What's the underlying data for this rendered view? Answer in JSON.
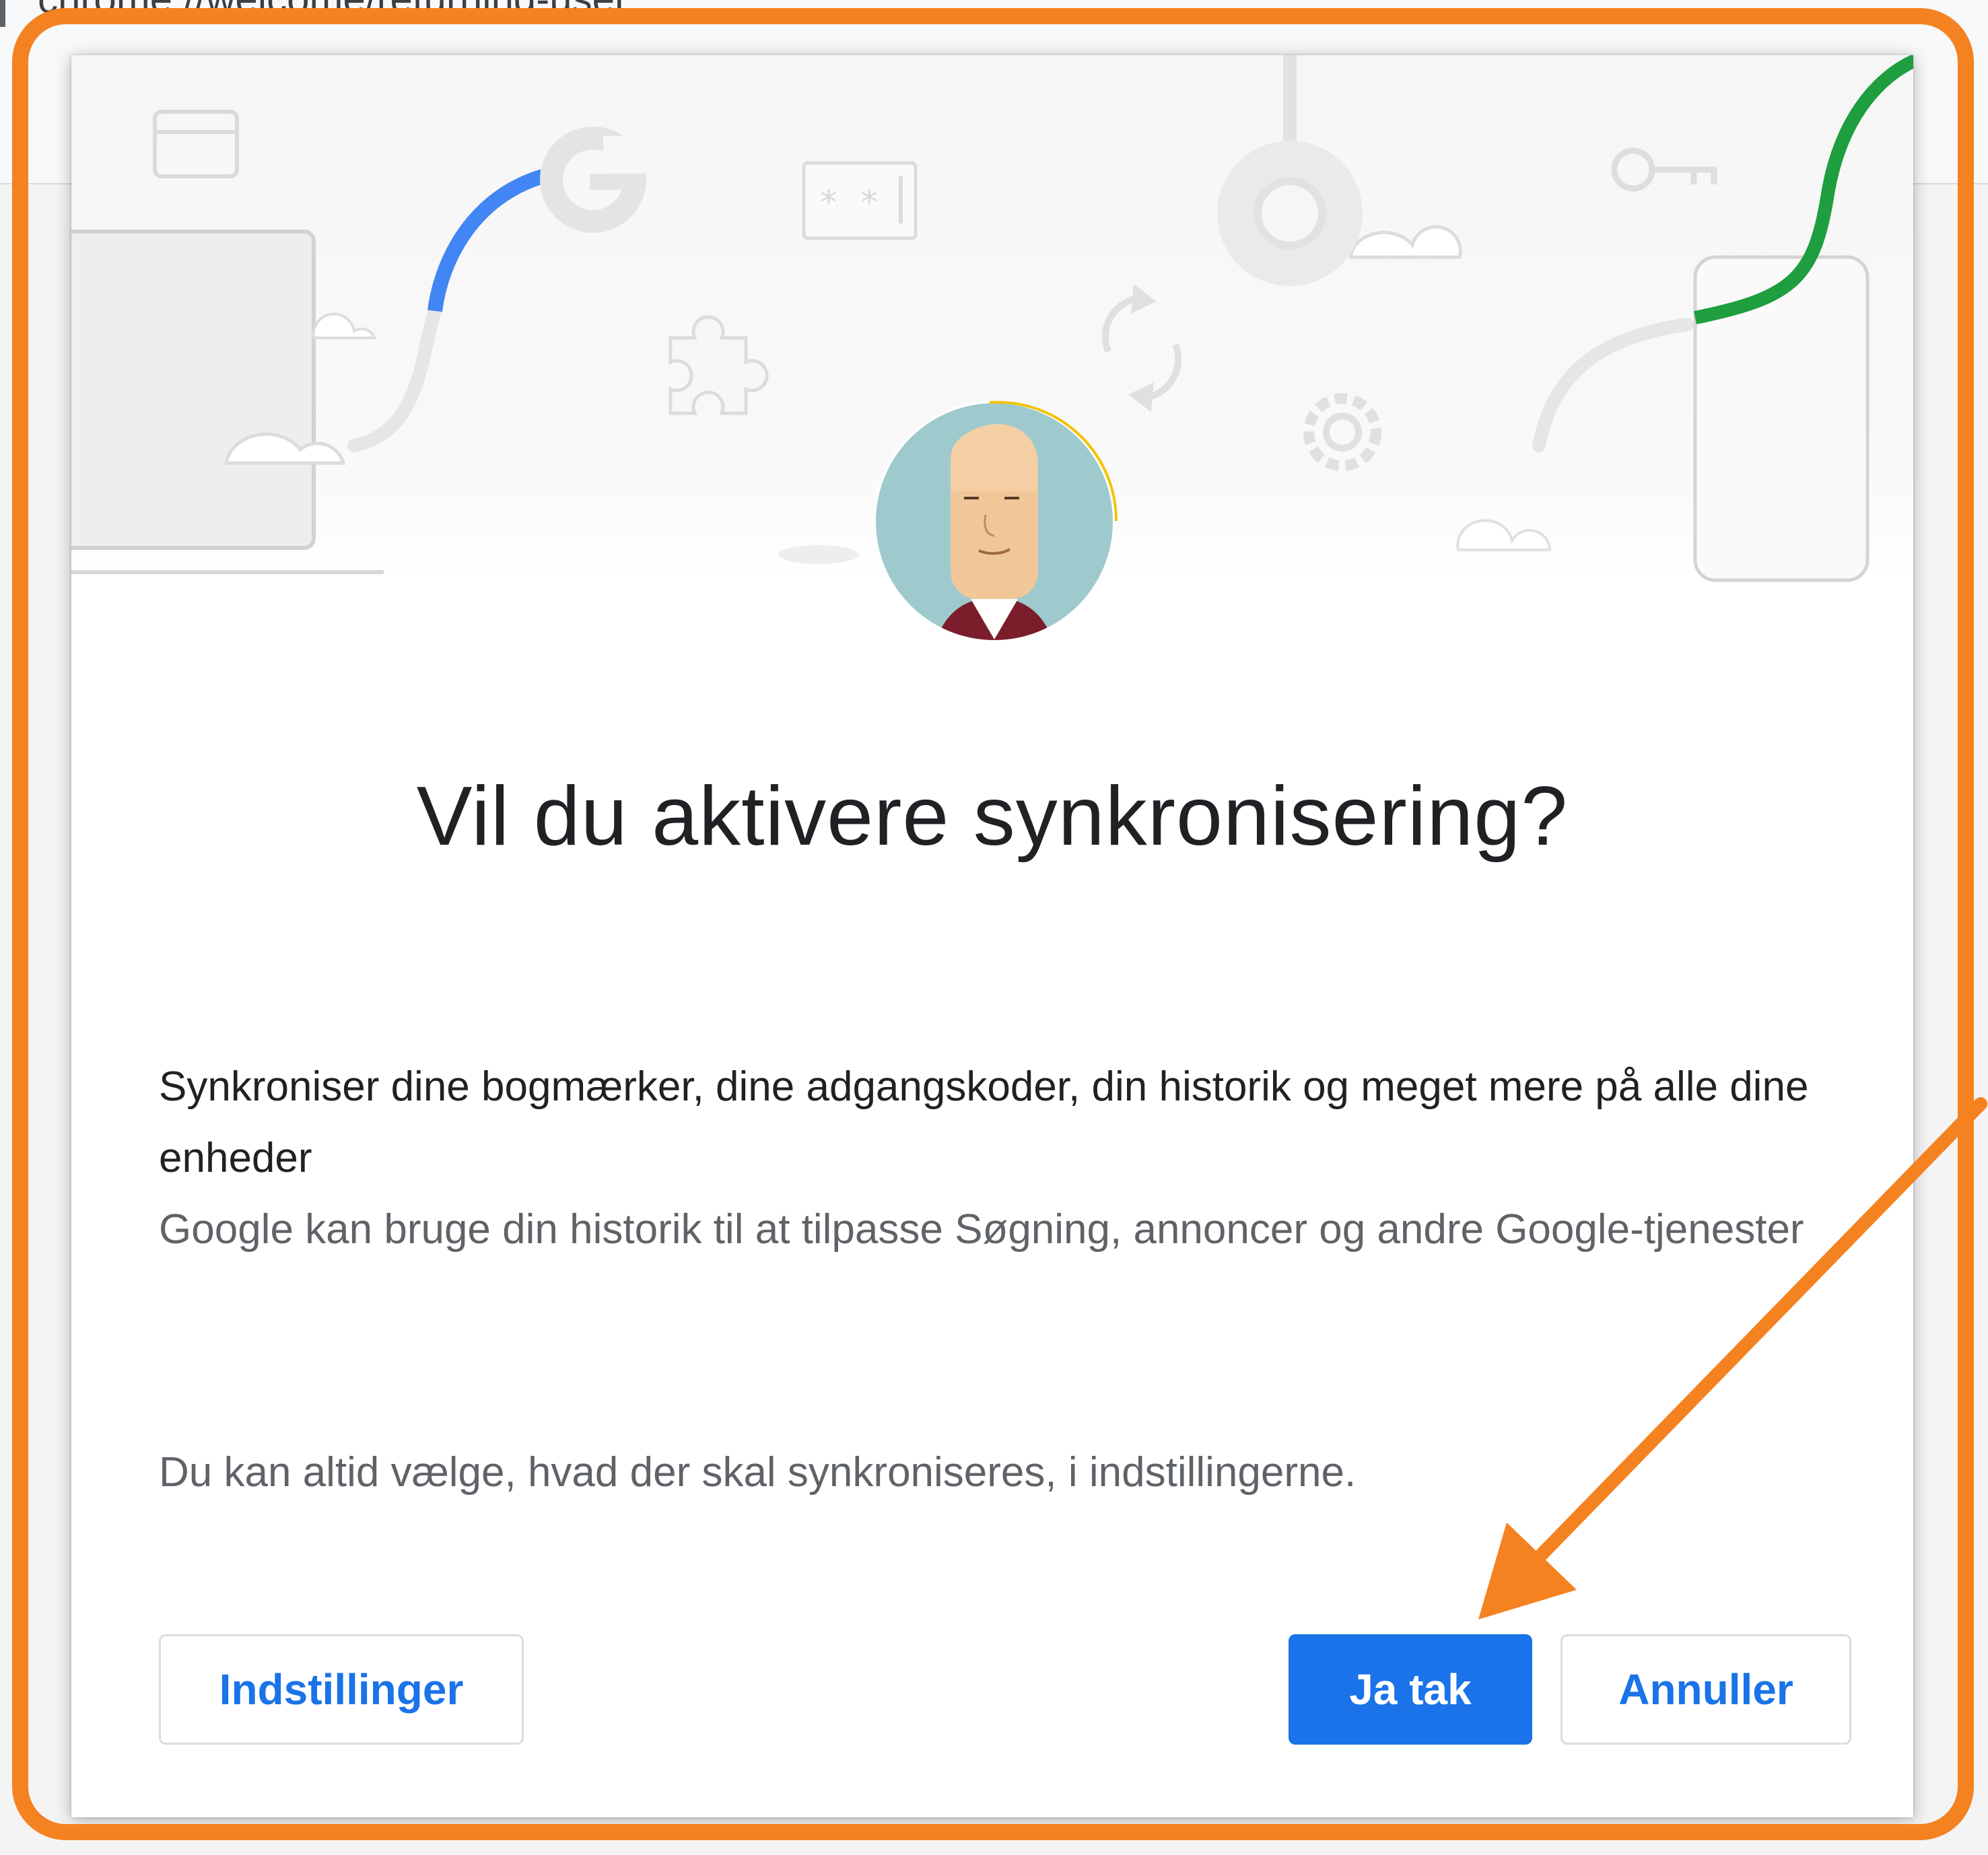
{
  "browser": {
    "url": "chrome://welcome/returning-user"
  },
  "dialog": {
    "title": "Vil du aktivere synkronisering?",
    "primary_text": "Synkroniser dine bogmærker, dine adgangskoder, din historik og meget mere på alle dine enheder",
    "secondary_text": "Google kan bruge din historik til at tilpasse Søgning, annoncer og andre Google-tjenester",
    "settings_note": "Du kan altid vælge, hvad der skal synkroniseres, i indstillingerne.",
    "buttons": {
      "settings_label": "Indstillinger",
      "confirm_label": "Ja tak",
      "cancel_label": "Annuller"
    }
  },
  "colors": {
    "accent_blue": "#1a73e8",
    "annotation_orange": "#f58220",
    "google_green": "#1e9e3e",
    "google_blue": "#4285f4",
    "avatar_ring_yellow": "#f2c200"
  },
  "icons": [
    "credit-card-icon",
    "google-g-icon",
    "password-field-icon",
    "chrome-logo-icon",
    "key-icon",
    "puzzle-extension-icon",
    "sync-icon",
    "gear-icon",
    "cloud-icon",
    "laptop-icon",
    "phone-icon",
    "user-avatar"
  ]
}
